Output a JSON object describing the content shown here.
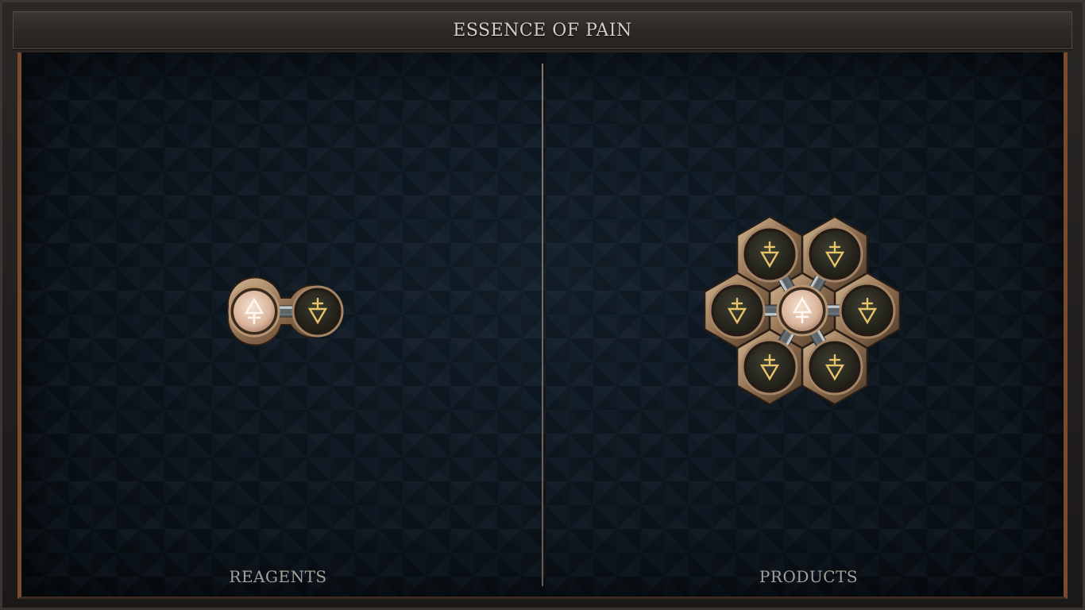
{
  "header": {
    "title": "ESSENCE OF PAIN"
  },
  "panels": {
    "reagents": {
      "label": "REAGENTS",
      "atoms": [
        {
          "element": "salt",
          "state": "lit",
          "icon": "salt-symbol-icon"
        },
        {
          "element": "fire",
          "state": "dark",
          "icon": "fire-symbol-icon"
        }
      ],
      "bonds": 1
    },
    "products": {
      "label": "PRODUCTS",
      "center": {
        "element": "salt",
        "state": "lit",
        "icon": "salt-symbol-icon"
      },
      "ring": [
        {
          "element": "fire",
          "icon": "fire-symbol-icon"
        },
        {
          "element": "fire",
          "icon": "fire-symbol-icon"
        },
        {
          "element": "fire",
          "icon": "fire-symbol-icon"
        },
        {
          "element": "fire",
          "icon": "fire-symbol-icon"
        },
        {
          "element": "fire",
          "icon": "fire-symbol-icon"
        },
        {
          "element": "fire",
          "icon": "fire-symbol-icon"
        }
      ],
      "bonds": 6
    }
  },
  "colors": {
    "board": "#0f1a24",
    "frame_accent": "#7c4a2c",
    "bronze": "#a98b6a",
    "lit_atom": "#e8c8b0",
    "dark_atom": "#2c2b22",
    "glyph_gold": "#e7c36a",
    "glyph_copper": "#f4ece4"
  }
}
